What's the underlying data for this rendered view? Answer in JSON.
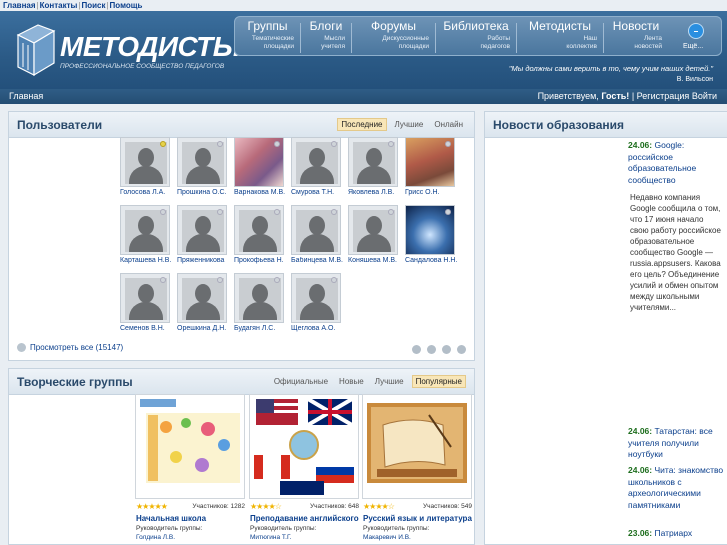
{
  "toplinks": [
    "Главная",
    "Контакты",
    "Поиск",
    "Помощь"
  ],
  "logo": {
    "name": "МЕТОДИСТЫ",
    "tagline": "ПРОФЕССИОНАЛЬНОЕ СООБЩЕСТВО ПЕДАГОГОВ"
  },
  "nav": [
    {
      "title": "Группы",
      "sub1": "Тематические",
      "sub2": "площадки"
    },
    {
      "title": "Блоги",
      "sub1": "Мысли",
      "sub2": "учителя"
    },
    {
      "title": "Форумы",
      "sub1": "Дискуссионные",
      "sub2": "площадки"
    },
    {
      "title": "Библиотека",
      "sub1": "Работы",
      "sub2": "педагогов"
    },
    {
      "title": "Методисты",
      "sub1": "Наш",
      "sub2": "коллектив"
    },
    {
      "title": "Новости",
      "sub1": "Лента",
      "sub2": "новостей"
    }
  ],
  "more_label": "Ещё...",
  "quote": {
    "text": "\"Мы должны сами верить в то, чему учим наших детей.\"",
    "author": "В. Вильсон"
  },
  "bar": {
    "home": "Главная",
    "greeting": "Приветствуем,",
    "guest": "Гость!",
    "register": "Регистрация",
    "login": "Войти"
  },
  "users_panel": {
    "title": "Пользователи",
    "tabs": [
      "Последние",
      "Лучшие",
      "Онлайн"
    ],
    "active_tab": "Последние",
    "view_all": "Просмотреть все (15147)",
    "users": [
      {
        "name": "Голосова Л.А.",
        "photo": "silhouette",
        "online": true
      },
      {
        "name": "Прошкина О.С.",
        "photo": "silhouette",
        "online": false
      },
      {
        "name": "Варнакова М.В.",
        "photo": "photo",
        "online": false
      },
      {
        "name": "Смурова Т.Н.",
        "photo": "silhouette",
        "online": false
      },
      {
        "name": "Яковлева Л.В.",
        "photo": "silhouette",
        "online": false
      },
      {
        "name": "Грисс О.Н.",
        "photo": "photo",
        "online": false
      },
      {
        "name": "Карташева Н.В.",
        "photo": "silhouette",
        "online": false
      },
      {
        "name": "Пряженникова",
        "photo": "silhouette",
        "online": false
      },
      {
        "name": "Прокофьева Н.",
        "photo": "silhouette",
        "online": false
      },
      {
        "name": "Бабинцева М.В.",
        "photo": "silhouette",
        "online": false
      },
      {
        "name": "Коняшева М.В.",
        "photo": "silhouette",
        "online": false
      },
      {
        "name": "Сандалова Н.Н.",
        "photo": "photo",
        "online": false
      },
      {
        "name": "Семенов В.Н.",
        "photo": "silhouette",
        "online": false
      },
      {
        "name": "Орешкина Д.Н.",
        "photo": "silhouette",
        "online": false
      },
      {
        "name": "Будагян Л.С.",
        "photo": "silhouette",
        "online": false
      },
      {
        "name": "Щеглова А.О.",
        "photo": "silhouette",
        "online": false
      }
    ]
  },
  "groups_panel": {
    "title": "Творческие группы",
    "tabs": [
      "Официальные",
      "Новые",
      "Лучшие",
      "Популярные"
    ],
    "active_tab": "Популярные",
    "groups": [
      {
        "title": "Начальная школа",
        "members": "Участников: 1282",
        "rating": 5,
        "leader_label": "Руководитель группы:",
        "leader": "Голдина Л.В."
      },
      {
        "title": "Преподавание английского",
        "members": "Участников: 648",
        "rating": 4,
        "leader_label": "Руководитель группы:",
        "leader": "Митюгина Т.Г."
      },
      {
        "title": "Русский язык и литература",
        "members": "Участников: 549",
        "rating": 4,
        "leader_label": "Руководитель группы:",
        "leader": "Макаревич И.В."
      }
    ]
  },
  "news_panel": {
    "title": "Новости образования",
    "items": [
      {
        "date": "24.06:",
        "text": "Google: российское образовательное сообщество"
      },
      {
        "date": "24.06:",
        "text": "Татарстан: все учителя получили ноутбуки"
      },
      {
        "date": "24.06:",
        "text": "Чита: знакомство школьников с археологическими памятниками"
      },
      {
        "date": "23.06:",
        "text": "Патриарх"
      }
    ],
    "excerpt": "Недавно компания Google сообщила о том, что 17 июня начало свою работу российское образовательное сообщество Google — russia.appsusers. Какова его цель? Объединение усилий и обмен опытом между школьными учителями..."
  },
  "colors": {
    "header": "#2b5a86",
    "link": "#0b3f8c",
    "news_date": "#1e6e1e",
    "active_tab": "#f8e6b8"
  }
}
